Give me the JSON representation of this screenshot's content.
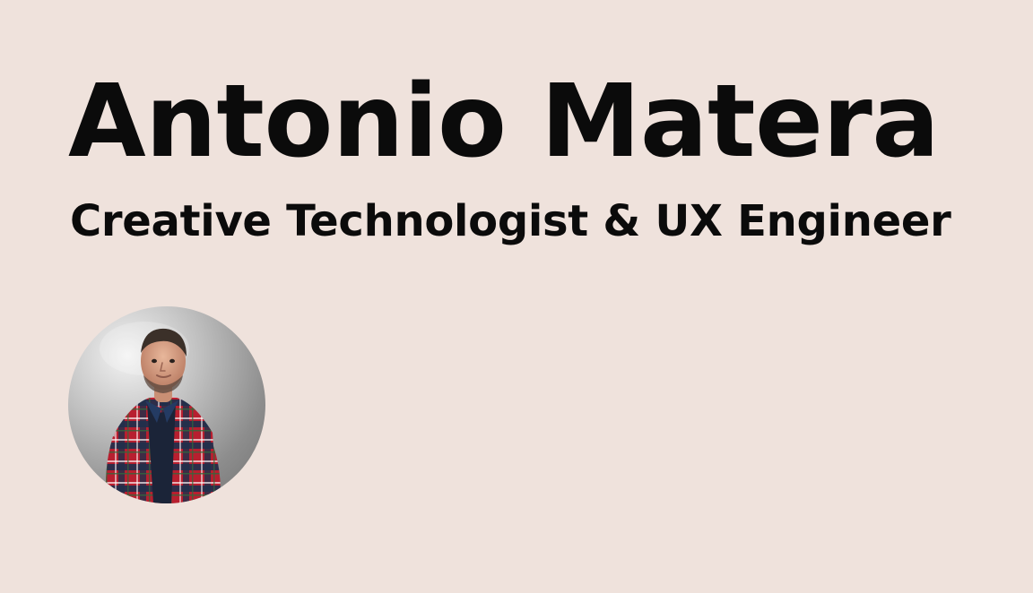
{
  "profile": {
    "name": "Antonio Matera",
    "role": "Creative Technologist & UX Engineer",
    "avatar_icon": "portrait-photo"
  },
  "colors": {
    "background": "#efe2dc",
    "text": "#0b0b0b"
  }
}
